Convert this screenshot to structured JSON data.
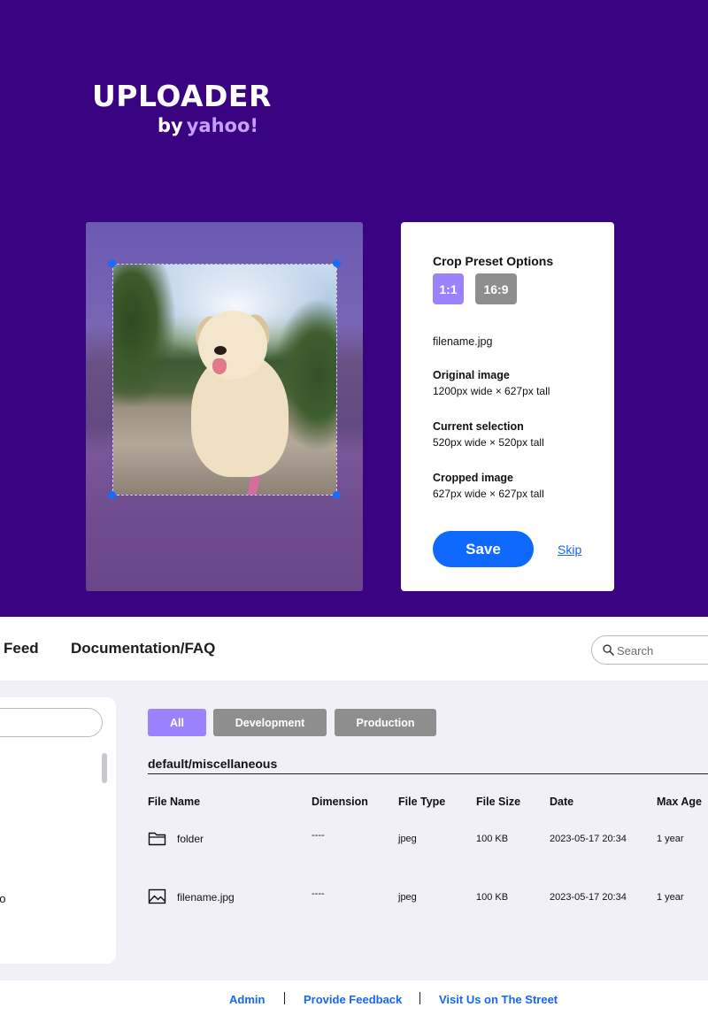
{
  "brand": {
    "name": "UPLOADER",
    "by": "by",
    "company": "yahoo!",
    "accent_color": "#3a0382",
    "highlight_color": "#9b82ff",
    "link_color": "#1466ff"
  },
  "crop": {
    "card_title": "Crop Preset Options",
    "presets": [
      {
        "label": "1:1",
        "selected": true
      },
      {
        "label": "16:9",
        "selected": false
      }
    ],
    "filename": "filename.jpg",
    "original": {
      "label": "Original image",
      "value": "1200px wide × 627px tall"
    },
    "current": {
      "label": "Current selection",
      "value": "520px wide × 520px tall"
    },
    "cropped": {
      "label": "Cropped image",
      "value": "627px wide × 627px tall"
    },
    "save_label": "Save",
    "skip_label": "Skip"
  },
  "nav": {
    "items": [
      {
        "label": "Feed"
      },
      {
        "label": "Documentation/FAQ"
      }
    ],
    "search_placeholder": "Search"
  },
  "sidebar": {
    "visible_label": "oo"
  },
  "filters": [
    {
      "label": "All",
      "selected": true
    },
    {
      "label": "Development",
      "selected": false
    },
    {
      "label": "Production",
      "selected": false
    }
  ],
  "browser": {
    "path": "default/miscellaneous",
    "columns": [
      "File Name",
      "Dimension",
      "File Type",
      "File Size",
      "Date",
      "Max Age"
    ],
    "rows": [
      {
        "icon": "folder-icon",
        "name": "folder",
        "dimension": "----",
        "type": "jpeg",
        "size": "100 KB",
        "date": "2023-05-17 20:34",
        "max_age": "1 year"
      },
      {
        "icon": "image-icon",
        "name": "filename.jpg",
        "dimension": "----",
        "type": "jpeg",
        "size": "100 KB",
        "date": "2023-05-17 20:34",
        "max_age": "1 year"
      }
    ]
  },
  "footer": {
    "links": [
      {
        "label": "Admin"
      },
      {
        "label": "Provide Feedback"
      },
      {
        "label": "Visit Us on The Street"
      }
    ],
    "separator": "|"
  }
}
